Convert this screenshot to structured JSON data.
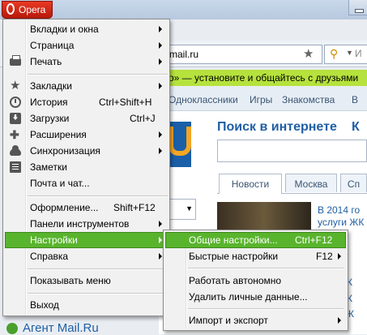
{
  "titlebar": {
    "opera_label": "Opera"
  },
  "browser": {
    "address": "mail.ru",
    "search_placeholder": "И",
    "banner": "о» — установите и общайтесь с друзьями",
    "nav": [
      "Одноклассники",
      "Игры",
      "Знакомства",
      "В"
    ],
    "search_title": "Поиск в интернете",
    "search_title_tail": "К",
    "tabs": [
      "Новости",
      "Москва",
      "Сп"
    ],
    "news": [
      "В 2014 го",
      "услуги ЖК"
    ],
    "side_letters": [
      "И",
      "Ж",
      "Ж",
      "Ж"
    ],
    "agent": "Агент Mail.Ru"
  },
  "main_menu": {
    "items": [
      {
        "label": "Вкладки и окна",
        "shortcut": "",
        "submenu": true,
        "icon": ""
      },
      {
        "label": "Страница",
        "shortcut": "",
        "submenu": true,
        "icon": ""
      },
      {
        "label": "Печать",
        "shortcut": "",
        "submenu": true,
        "icon": "printer-icon"
      },
      {
        "label": "Закладки",
        "shortcut": "",
        "submenu": true,
        "icon": "star-icon"
      },
      {
        "label": "История",
        "shortcut": "Ctrl+Shift+H",
        "submenu": false,
        "icon": "clock-icon"
      },
      {
        "label": "Загрузки",
        "shortcut": "Ctrl+J",
        "submenu": false,
        "icon": "download-icon"
      },
      {
        "label": "Расширения",
        "shortcut": "",
        "submenu": true,
        "icon": "puzzle-icon"
      },
      {
        "label": "Синхронизация",
        "shortcut": "",
        "submenu": true,
        "icon": "cloud-icon"
      },
      {
        "label": "Заметки",
        "shortcut": "",
        "submenu": false,
        "icon": "notes-icon"
      },
      {
        "label": "Почта и чат...",
        "shortcut": "",
        "submenu": false,
        "icon": ""
      },
      {
        "label": "Оформление...",
        "shortcut": "Shift+F12",
        "submenu": false,
        "icon": ""
      },
      {
        "label": "Панели инструментов",
        "shortcut": "",
        "submenu": true,
        "icon": ""
      },
      {
        "label": "Настройки",
        "shortcut": "",
        "submenu": true,
        "icon": ""
      },
      {
        "label": "Справка",
        "shortcut": "",
        "submenu": true,
        "icon": ""
      },
      {
        "label": "Показывать меню",
        "shortcut": "",
        "submenu": false,
        "icon": ""
      },
      {
        "label": "Выход",
        "shortcut": "",
        "submenu": false,
        "icon": ""
      }
    ],
    "highlighted": "Настройки"
  },
  "settings_submenu": {
    "items": [
      {
        "label": "Общие настройки...",
        "shortcut": "Ctrl+F12",
        "submenu": false
      },
      {
        "label": "Быстрые настройки",
        "shortcut": "F12",
        "submenu": true
      },
      {
        "label": "Работать автономно",
        "shortcut": "",
        "submenu": false
      },
      {
        "label": "Удалить личные данные...",
        "shortcut": "",
        "submenu": false
      },
      {
        "label": "Импорт и экспорт",
        "shortcut": "",
        "submenu": true
      }
    ],
    "highlighted": "Общие настройки..."
  },
  "colors": {
    "highlight": "#59b42d",
    "opera_red": "#d12a16",
    "banner_green": "#b6e23d",
    "link_blue": "#1f5fa4"
  }
}
